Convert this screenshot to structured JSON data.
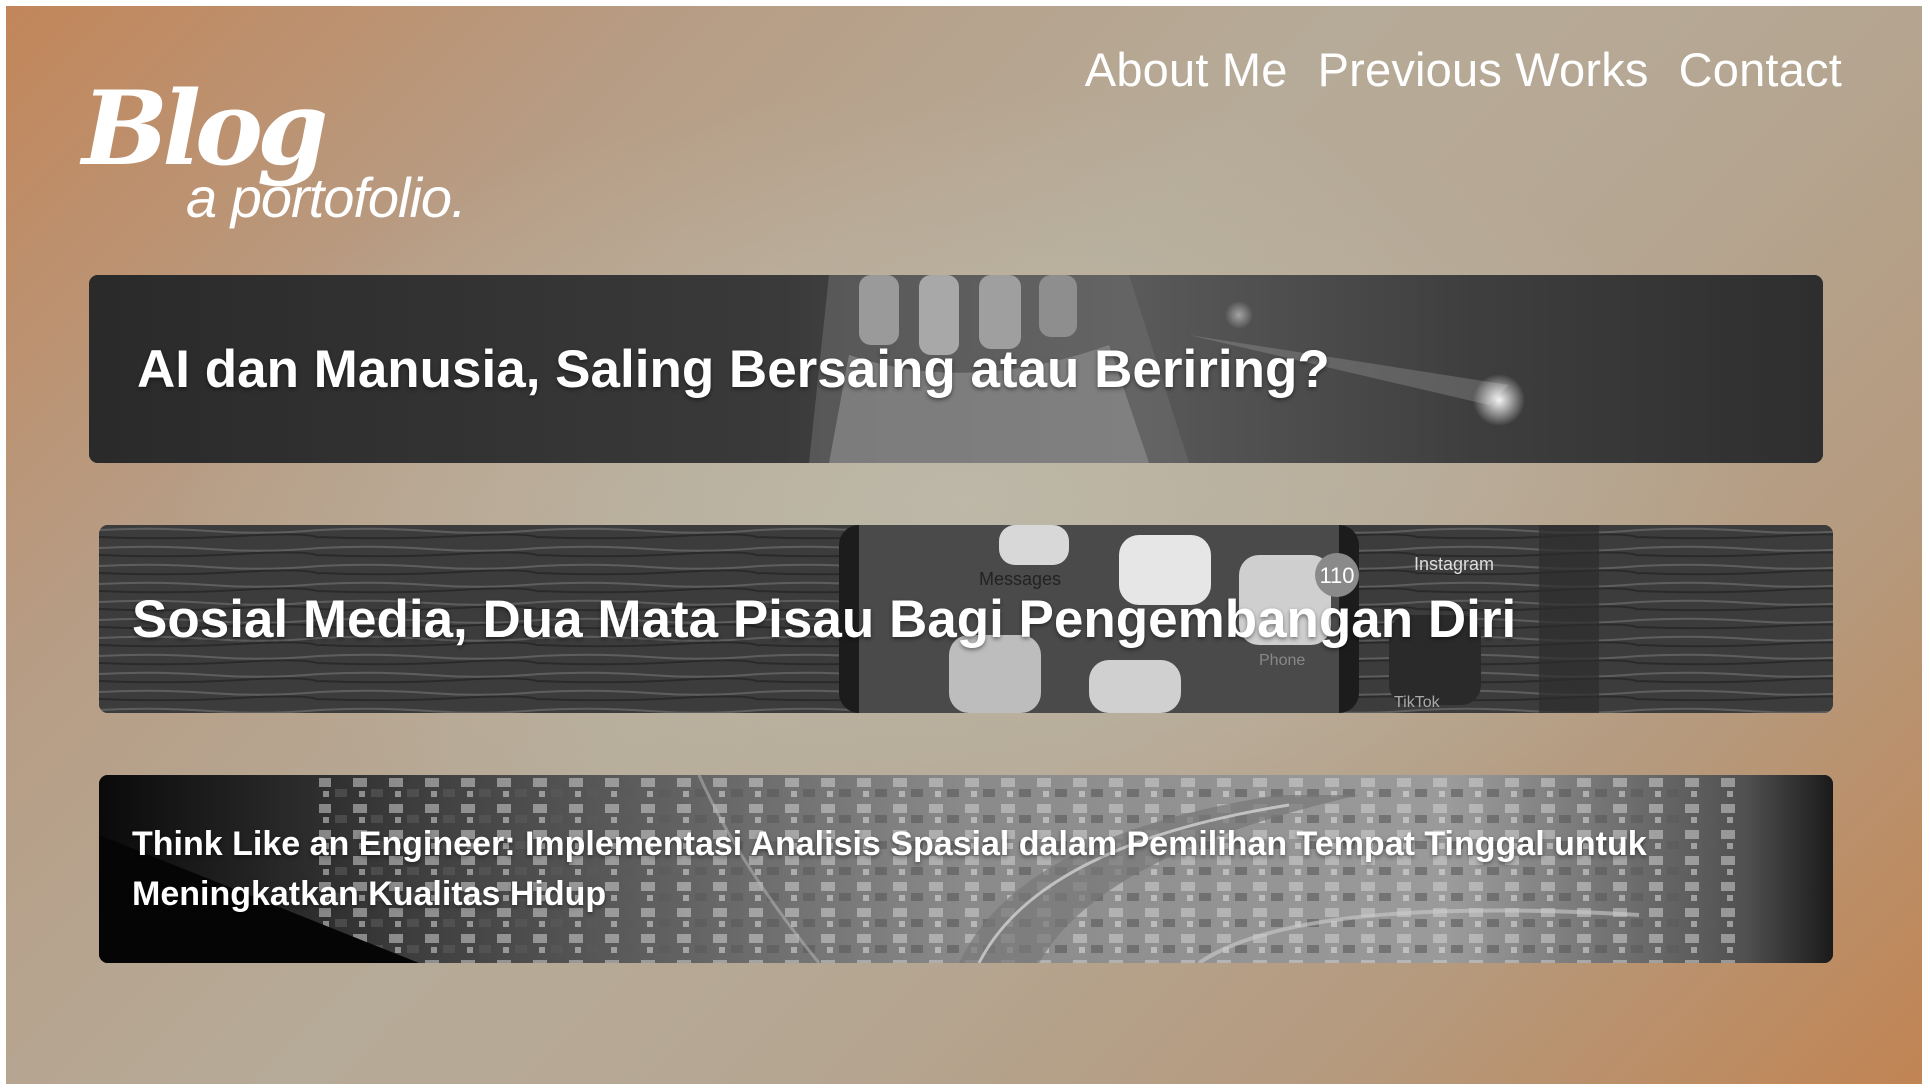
{
  "logo": {
    "title": "Blog",
    "subtitle": "a portofolio."
  },
  "nav": {
    "items": [
      {
        "label": "About Me"
      },
      {
        "label": "Previous Works"
      },
      {
        "label": "Contact"
      }
    ]
  },
  "posts": [
    {
      "title": "AI dan Manusia, Saling Bersaing atau Beriring?",
      "image": "robot-hand-photo"
    },
    {
      "title": "Sosial Media, Dua Mata Pisau Bagi Pengembangan Diri",
      "image": "smartphone-apps-photo",
      "image_text": {
        "messages": "Messages",
        "instagram": "Instagram",
        "badge": "110",
        "phone": "Phone",
        "tiktok": "TikTok"
      }
    },
    {
      "title": "Think Like an Engineer: Implementasi Analisis Spasial dalam Pemilihan Tempat Tinggal untuk Meningkatkan Kualitas Hidup",
      "image": "city-highway-aerial-photo"
    }
  ],
  "colors": {
    "text": "#ffffff",
    "background_warm": "#c2865a",
    "background_neutral": "#b6ab98"
  }
}
